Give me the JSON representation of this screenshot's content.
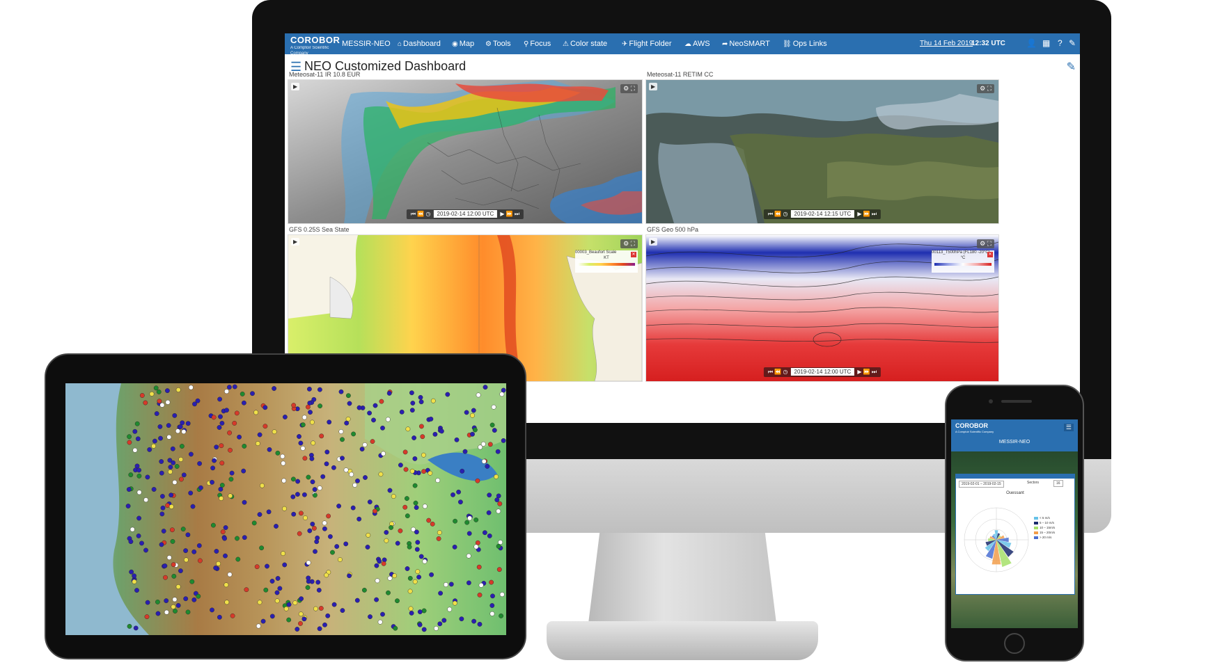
{
  "monitor": {
    "brand": {
      "name": "COROBOR",
      "sub": "A Comptoir Scientific Company"
    },
    "app_name": "MESSIR-NEO",
    "nav": [
      {
        "icon": "⌂",
        "label": "Dashboard",
        "icon_name": "dashboard-icon"
      },
      {
        "icon": "◉",
        "label": "Map",
        "icon_name": "globe-icon"
      },
      {
        "icon": "⚙",
        "label": "Tools",
        "icon_name": "cogs-icon"
      },
      {
        "icon": "⚲",
        "label": "Focus",
        "icon_name": "lightbulb-icon"
      },
      {
        "icon": "⚠",
        "label": "Color state",
        "icon_name": "warning-icon"
      },
      {
        "icon": "✈",
        "label": "Flight Folder",
        "icon_name": "plane-icon"
      },
      {
        "icon": "☁",
        "label": "AWS",
        "icon_name": "dashboard-gauge-icon"
      },
      {
        "icon": "➦",
        "label": "NeoSMART",
        "icon_name": "share-icon"
      },
      {
        "icon": "⛓",
        "label": "Ops Links",
        "icon_name": "link-icon"
      }
    ],
    "date": "Thu 14 Feb 2019",
    "time": "12:32 UTC",
    "right_icons": [
      "user-icon",
      "grid-icon",
      "help-icon",
      "wrench-icon"
    ],
    "right_icon_glyphs": [
      "👤",
      "▦",
      "?",
      "✎"
    ],
    "page_title": "NEO Customized Dashboard",
    "panels": [
      {
        "label": "Meteosat-11 IR 10.8 EUR",
        "timestamp": "2019-02-14 12:00 UTC"
      },
      {
        "label": "Meteosat-11 RETIM CC",
        "timestamp": "2019-02-14 12:15 UTC"
      },
      {
        "label": "GFS 0.25S Sea State",
        "legend": "00003_Beaufort Scale",
        "legend_unit": "KT"
      },
      {
        "label": "GFS Geo 500 hPa",
        "legend": "00113_T500hPa (FL180 -20°C)",
        "legend_unit": "°C",
        "timestamp": "2019-02-14 12:00 UTC"
      }
    ]
  },
  "phone": {
    "brand": "COROBOR",
    "brand_sub": "A Comptoir Scientific Company",
    "app_name": "MESSIR-NEO",
    "date_range": "2019-02-01 – 2019-02-15",
    "sectors_label": "Sectors",
    "sectors_value": "16",
    "rose_title": "Ouessant",
    "rose_legend": [
      "< 5 m/s",
      "5 – 10 m/s",
      "10 – 15m/s",
      "15 – 20m/s",
      "> 20 m/s"
    ],
    "rose_colors": [
      "#66c2e8",
      "#1a2a6c",
      "#a6e06a",
      "#f29d4a",
      "#4a6fd1"
    ]
  },
  "colors": {
    "nav_blue": "#2a6fb0"
  }
}
